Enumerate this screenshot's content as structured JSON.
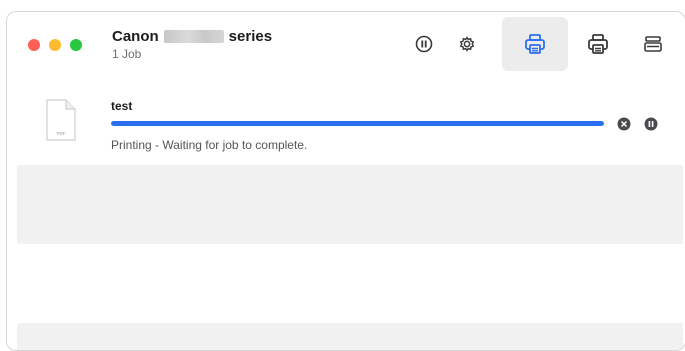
{
  "window": {
    "title_prefix": "Canon",
    "title_suffix": "series",
    "subtitle": "1 Job"
  },
  "toolbar": {
    "buttons": [
      {
        "icon": "pause-icon"
      },
      {
        "icon": "gear-icon"
      },
      {
        "icon": "printer-icon",
        "active": true
      },
      {
        "icon": "printer-icon"
      },
      {
        "icon": "scanner-icon"
      }
    ],
    "accent_color": "#2a6ff2"
  },
  "jobs": [
    {
      "file_type": "PDF",
      "name": "test",
      "status": "Printing - Waiting for job to complete.",
      "progress": 1.0
    }
  ],
  "colors": {
    "close": "#ff5f57",
    "minimize": "#febc2e",
    "zoom": "#28c840",
    "progress": "#2a6ff2"
  }
}
